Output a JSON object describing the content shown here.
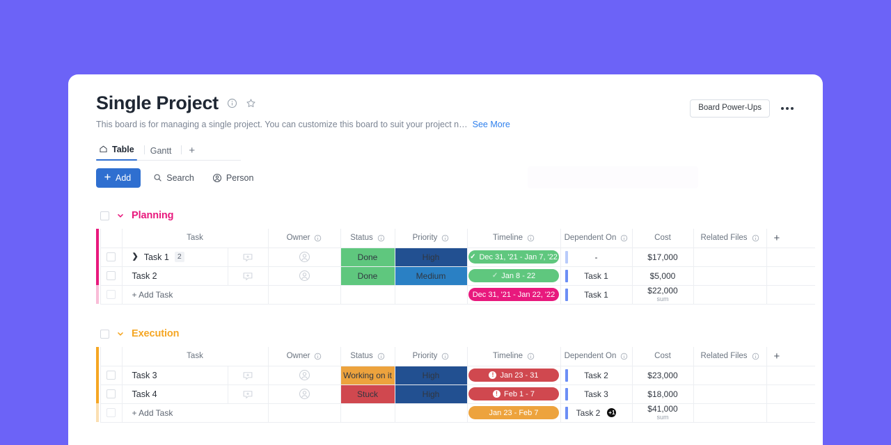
{
  "theme": {
    "page_bg": "#6c63f7",
    "accent_blue": "#2f6fd0",
    "planning_color": "#e8197d",
    "execution_color": "#f5a623"
  },
  "header": {
    "title": "Single Project",
    "info_icon": "info-circle-icon",
    "star_icon": "star-icon",
    "description": "This board is for managing a single project. You can customize this board to suit your project n…",
    "see_more": "See More",
    "power_ups_label": "Board Power-Ups",
    "more_icon": "kebab-menu-icon"
  },
  "tabs": [
    {
      "label": "Table",
      "icon": "home-icon",
      "active": true
    },
    {
      "label": "Gantt",
      "icon": "",
      "active": false
    }
  ],
  "tab_add_label": "+",
  "toolbar": {
    "add_label": "Add",
    "add_icon": "plus-icon",
    "search_label": "Search",
    "search_icon": "search-icon",
    "person_label": "Person",
    "person_icon": "person-icon"
  },
  "columns": [
    {
      "key": "task",
      "label": "Task",
      "info": false
    },
    {
      "key": "owner",
      "label": "Owner",
      "info": true
    },
    {
      "key": "status",
      "label": "Status",
      "info": true
    },
    {
      "key": "priority",
      "label": "Priority",
      "info": true
    },
    {
      "key": "timeline",
      "label": "Timeline",
      "info": true
    },
    {
      "key": "dependent",
      "label": "Dependent On",
      "info": true
    },
    {
      "key": "cost",
      "label": "Cost",
      "info": false
    },
    {
      "key": "files",
      "label": "Related Files",
      "info": true
    }
  ],
  "add_column_label": "+",
  "add_task_label": "+ Add Task",
  "groups": [
    {
      "name": "Planning",
      "color": "#e8197d",
      "color_faded": "#f9bcd7",
      "collapse_icon": "chevron-down-icon",
      "rows": [
        {
          "task": "Task 1",
          "expandable": true,
          "subitem_count": "2",
          "owner": "avatar-placeholder-icon",
          "comment": "add-comment-icon",
          "status": {
            "text": "Done",
            "color": "#5fc77e"
          },
          "priority": {
            "text": "High",
            "color": "#225091"
          },
          "timeline": {
            "text": "Dec 31, '21 - Jan 7, '22",
            "color": "#5fc77e",
            "icon": "check",
            "faded": false
          },
          "dependent": {
            "text": "-",
            "bar_faded": true,
            "extra": ""
          },
          "cost": "$17,000",
          "files": ""
        },
        {
          "task": "Task 2",
          "expandable": false,
          "subitem_count": "",
          "owner": "avatar-placeholder-icon",
          "comment": "add-comment-icon",
          "status": {
            "text": "Done",
            "color": "#5fc77e"
          },
          "priority": {
            "text": "Medium",
            "color": "#2a80c4"
          },
          "timeline": {
            "text": "Jan 8 - 22",
            "color": "#5fc77e",
            "icon": "check",
            "faded": true
          },
          "dependent": {
            "text": "Task 1",
            "bar_faded": false,
            "extra": ""
          },
          "cost": "$5,000",
          "files": ""
        }
      ],
      "summary": {
        "timeline": {
          "text": "Dec 31, '21 - Jan 22, '22",
          "color": "#e8197d",
          "icon": "",
          "faded": false
        },
        "dependent": {
          "text": "Task 1",
          "bar_faded": false,
          "extra": ""
        },
        "cost": "$22,000",
        "cost_sublabel": "sum"
      }
    },
    {
      "name": "Execution",
      "color": "#f5a623",
      "color_faded": "#fbdfb2",
      "collapse_icon": "chevron-down-icon",
      "rows": [
        {
          "task": "Task 3",
          "expandable": false,
          "subitem_count": "",
          "owner": "avatar-placeholder-icon",
          "comment": "add-comment-icon",
          "status": {
            "text": "Working on it",
            "color": "#eda33d"
          },
          "priority": {
            "text": "High",
            "color": "#225091"
          },
          "timeline": {
            "text": "Jan 23 - 31",
            "color": "#d0484f",
            "icon": "bang",
            "faded": false
          },
          "dependent": {
            "text": "Task 2",
            "bar_faded": false,
            "extra": ""
          },
          "cost": "$23,000",
          "files": ""
        },
        {
          "task": "Task 4",
          "expandable": false,
          "subitem_count": "",
          "owner": "avatar-placeholder-icon",
          "comment": "add-comment-icon",
          "status": {
            "text": "Stuck",
            "color": "#d0484f"
          },
          "priority": {
            "text": "High",
            "color": "#225091"
          },
          "timeline": {
            "text": "Feb 1 - 7",
            "color": "#d0484f",
            "icon": "bang",
            "faded": false
          },
          "dependent": {
            "text": "Task 3",
            "bar_faded": false,
            "extra": ""
          },
          "cost": "$18,000",
          "files": ""
        }
      ],
      "summary": {
        "timeline": {
          "text": "Jan 23 - Feb 7",
          "color": "#eda33d",
          "icon": "",
          "faded": false
        },
        "dependent": {
          "text": "Task 2",
          "bar_faded": false,
          "extra": "+1"
        },
        "cost": "$41,000",
        "cost_sublabel": "sum"
      }
    }
  ]
}
